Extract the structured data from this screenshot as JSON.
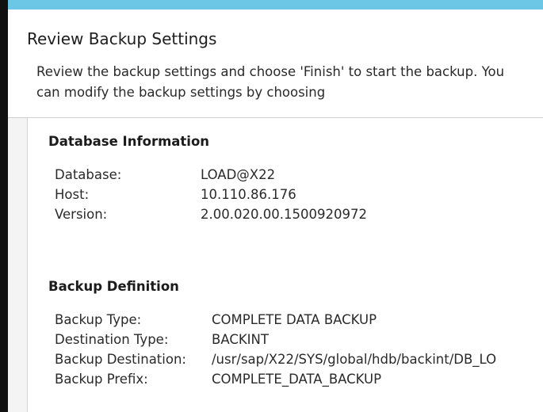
{
  "page": {
    "title": "Review Backup Settings",
    "description": "Review the backup settings and choose 'Finish' to start the backup. You can modify the backup settings by choosing"
  },
  "database_information": {
    "title": "Database Information",
    "fields": [
      {
        "label": "Database:",
        "value": "LOAD@X22"
      },
      {
        "label": "Host:",
        "value": "10.110.86.176"
      },
      {
        "label": "Version:",
        "value": "2.00.020.00.1500920972"
      }
    ]
  },
  "backup_definition": {
    "title": "Backup Definition",
    "fields": [
      {
        "label": "Backup Type:",
        "value": "COMPLETE DATA BACKUP"
      },
      {
        "label": "Destination Type:",
        "value": "BACKINT"
      },
      {
        "label": "Backup Destination:",
        "value": "/usr/sap/X22/SYS/global/hdb/backint/DB_LO"
      },
      {
        "label": "Backup Prefix:",
        "value": "COMPLETE_DATA_BACKUP"
      }
    ]
  },
  "colors": {
    "accent_bar": "#6cc6e5",
    "window_edge": "#111111"
  }
}
